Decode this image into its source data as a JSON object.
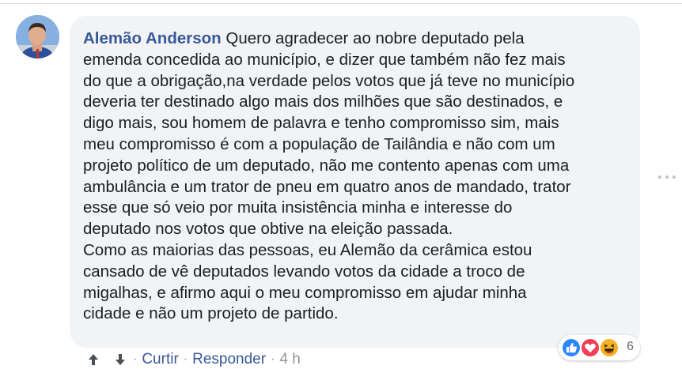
{
  "comment": {
    "author": "Alemão Anderson",
    "text": "Quero agradecer ao nobre deputado pela\nemenda concedida ao município, e dizer que também não fez mais\ndo que a obrigação,na verdade pelos votos que já teve no município\ndeveria ter destinado algo mais dos milhões que são destinados, e\ndigo mais, sou homem de palavra e tenho compromisso sim, mais\nmeu compromisso é com a população de Tailândia e não com um\nprojeto político de um deputado, não me contento apenas com uma\nambulância e um trator de pneu em quatro anos de mandado, trator\nesse que só veio por muita insistência minha e interesse do\ndeputado nos votos que obtive na eleição passada.\nComo as maiorias das pessoas, eu Alemão da cerâmica estou\ncansado de vê deputados levando votos da cidade a troco de\nmigalhas, e afirmo aqui o meu compromisso em ajudar minha\ncidade e não um projeto de partido."
  },
  "reactions": {
    "count": "6",
    "types": [
      "like-icon",
      "love-icon",
      "haha-icon"
    ]
  },
  "actions": {
    "separator": "·",
    "like_label": "Curtir",
    "reply_label": "Responder",
    "time": "4 h"
  },
  "colors": {
    "link": "#385898",
    "bubble": "#f2f3f5",
    "text": "#1c1e21",
    "muted": "#90949c"
  }
}
